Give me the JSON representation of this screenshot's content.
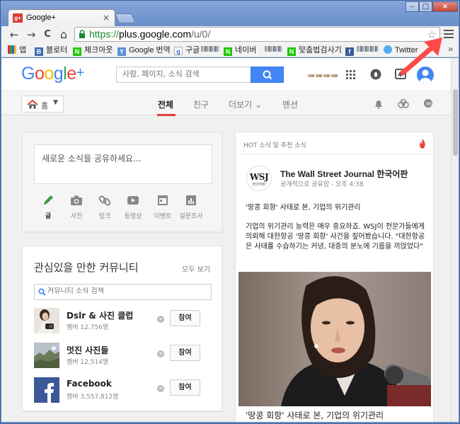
{
  "browser": {
    "tab_title": "Google+",
    "tab_favicon": "g+",
    "tab_close": "×",
    "window_buttons": {
      "minimize": "–",
      "maximize": "□",
      "close": "×"
    },
    "nav": {
      "back": "←",
      "forward": "→",
      "reload": "C",
      "home": "⌂"
    },
    "url": {
      "scheme": "https://",
      "host": "plus.google.com",
      "path": "/u/0/"
    },
    "bookmarks": [
      {
        "label": "앱",
        "icon": "apps-grid-icon"
      },
      {
        "label": "블로터",
        "icon": "blog-b-icon",
        "icon_text": "B"
      },
      {
        "label": "체크아웃",
        "icon": "naver-n-icon",
        "icon_text": "N"
      },
      {
        "label": "Google 번역",
        "icon": "yahoo-icon",
        "icon_text": "Y"
      },
      {
        "label": "구글",
        "icon": "google-g-icon",
        "icon_text": "g"
      },
      {
        "label": "네이버",
        "icon": "naver-n-icon",
        "icon_text": "N"
      },
      {
        "label": "맞춤법검사기",
        "icon": "naver-n-icon",
        "icon_text": "N"
      },
      {
        "label": "",
        "icon": "facebook-icon",
        "icon_text": "f"
      },
      {
        "label": "Twitter",
        "icon": "twitter-icon",
        "icon_text": "t"
      }
    ],
    "bookmarks_more": "»"
  },
  "gplus": {
    "logo": {
      "g1": "G",
      "o1": "o",
      "o2": "o",
      "g2": "g",
      "l": "l",
      "e": "e",
      "plus": "+"
    },
    "search_placeholder": "사람, 페이지, 소식 검색",
    "nav": {
      "home_label": "홈",
      "tabs": [
        "전체",
        "친구",
        "더보기",
        "멘션"
      ],
      "more_chevron": "⌄"
    },
    "share": {
      "placeholder": "새로운 소식을 공유하세요...",
      "tools": [
        "글",
        "사진",
        "링크",
        "동영상",
        "이벤트",
        "설문조사"
      ]
    },
    "communities": {
      "title": "관심있을 만한 커뮤니티",
      "see_all": "모두 보기",
      "search_placeholder": "커뮤니티 소식 검색",
      "join_label": "참여",
      "items": [
        {
          "name": "Dslr & 사진 클럽",
          "members": "멤버 12,756명"
        },
        {
          "name": "멋진 사진들",
          "members": "멤버 12,514명"
        },
        {
          "name": "Facebook",
          "members": "멤버 3,557,812명"
        }
      ]
    },
    "hot": {
      "title": "HOT 소식 및 추천 소식",
      "author": "The Wall Street Journal 한국어판",
      "logo_text": "WSJ",
      "logo_sub": "한국어판",
      "meta": "공개적으로 공유함 - 오후 4:38",
      "headline": "'땅콩 회항' 사태로 본, 기업의 위기관리",
      "body": "기업의 위기관리 능력은 매우 중요하죠. WSJ이 전문가들에게 의뢰해 대한항공 '땅콩 회항' 사건을 짚어봤습니다. \"대한항공은 사태를 수습하기는 커녕, 대중의 분노에 기름을 끼얹었다\"",
      "caption": "'땅콩 회항' 사태로 본, 기업의 위기관리"
    },
    "colors": {
      "google_blue": "#4285f4",
      "google_red": "#ea4335",
      "google_yellow": "#fbbc05",
      "google_green": "#34a853",
      "share_green": "#3c9a3c",
      "arrow_red": "#ff4040"
    }
  }
}
